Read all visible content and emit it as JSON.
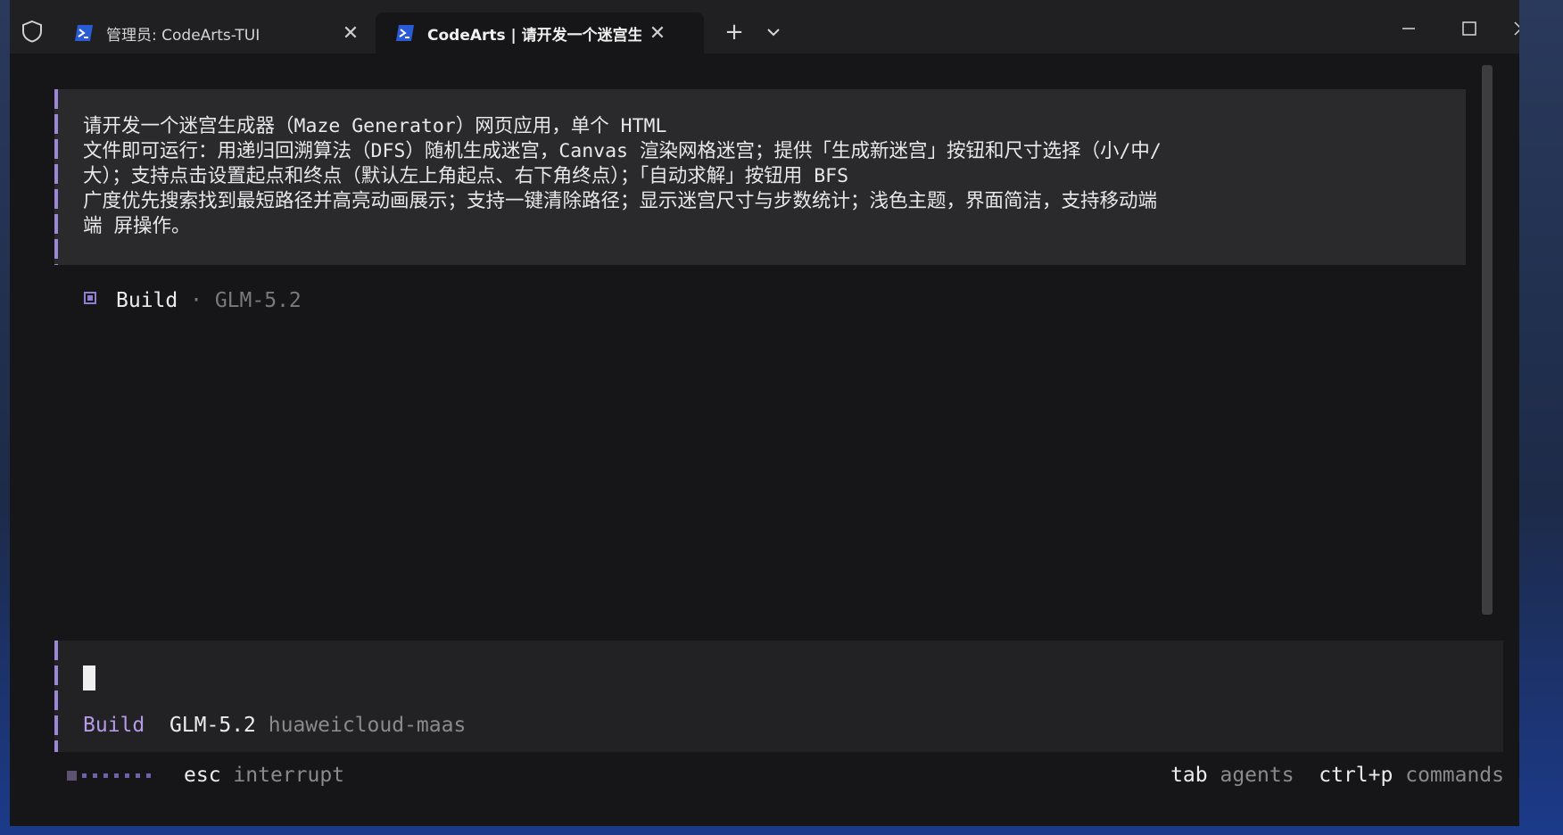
{
  "titlebar": {
    "tabs": [
      {
        "title": "管理员: CodeArts-TUI",
        "active": false
      },
      {
        "title": "CodeArts | 请开发一个迷宫生成",
        "active": true
      }
    ],
    "icons": {
      "security": "shield-icon",
      "tab": "powershell-icon",
      "close": "close-icon"
    },
    "close_glyph": "✕",
    "new_tab_glyph": "+"
  },
  "terminal": {
    "prompt_lines": [
      "请开发一个迷宫生成器（Maze Generator）网页应用，单个 HTML",
      "文件即可运行：用递归回溯算法（DFS）随机生成迷宫，Canvas 渲染网格迷宫；提供「生成新迷宫」按钮和尺寸选择（小/中/",
      "大）；支持点击设置起点和终点（默认左上角起点、右下角终点）；「自动求解」按钮用 BFS",
      "广度优先搜索找到最短路径并高亮动画展示；支持一键清除路径；显示迷宫尺寸与步数统计；浅色主题，界面简洁，支持移动端",
      "端 屏操作。"
    ],
    "build": {
      "label": "Build",
      "separator": "·",
      "model": "GLM-5.2"
    },
    "input": {
      "agent": "Build",
      "model": "GLM-5.2",
      "provider": "huaweicloud-maas"
    },
    "status": {
      "esc_key": "esc",
      "esc_action": "interrupt",
      "tab_key": "tab",
      "tab_action": "agents",
      "cmd_key": "ctrl+p",
      "cmd_action": "commands"
    }
  },
  "colors": {
    "accent": "#9d86d8",
    "background": "#161618",
    "panel": "#2a2a2d"
  }
}
